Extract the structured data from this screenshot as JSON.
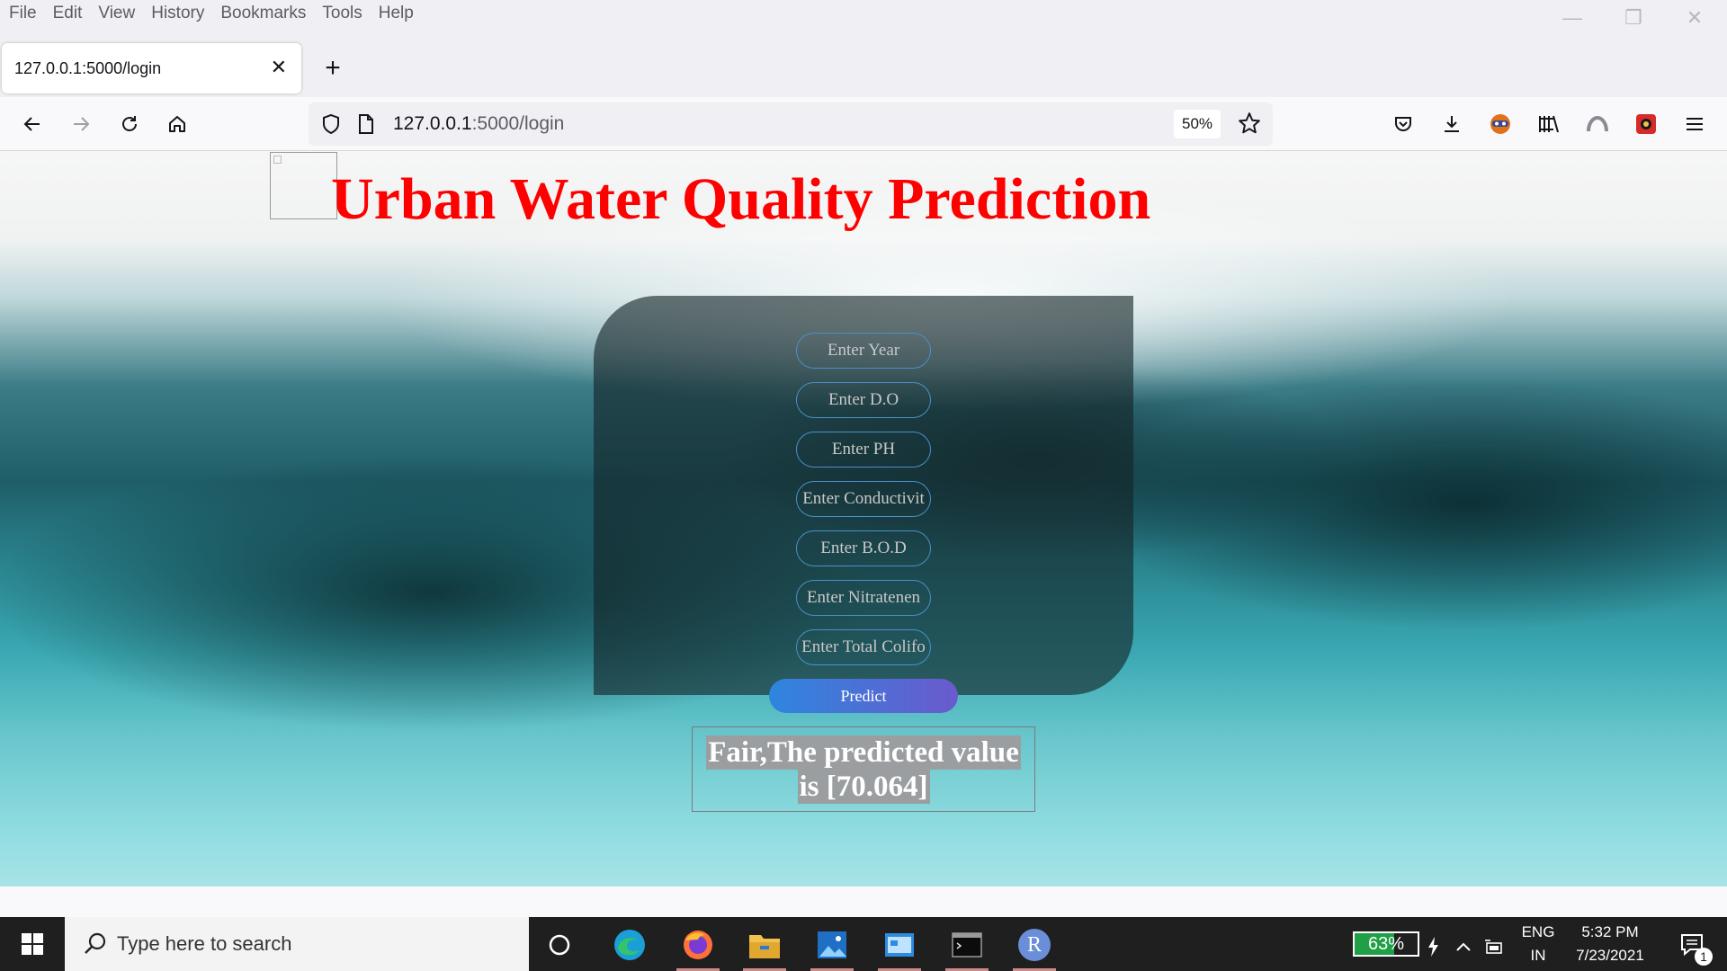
{
  "menu": [
    "File",
    "Edit",
    "View",
    "History",
    "Bookmarks",
    "Tools",
    "Help"
  ],
  "tab": {
    "title": "127.0.0.1:5000/login"
  },
  "url": {
    "host": "127.0.0.1",
    "path": ":5000/login",
    "zoom": "50%"
  },
  "page": {
    "title": "Urban Water Quality Prediction",
    "fields": [
      {
        "placeholder": "Enter Year"
      },
      {
        "placeholder": "Enter D.O"
      },
      {
        "placeholder": "Enter PH"
      },
      {
        "placeholder": "Enter Conductivit"
      },
      {
        "placeholder": "Enter B.O.D"
      },
      {
        "placeholder": "Enter Nitratenen"
      },
      {
        "placeholder": "Enter Total Colifo"
      }
    ],
    "predict_label": "Predict",
    "result_line1": "Fair,The predicted value",
    "result_line2": "is [70.064]"
  },
  "taskbar": {
    "search_placeholder": "Type here to search",
    "battery": "63%",
    "lang_top": "ENG",
    "lang_bottom": "IN",
    "time": "5:32 PM",
    "date": "7/23/2021",
    "notif_count": "1",
    "r_app_letter": "R"
  }
}
